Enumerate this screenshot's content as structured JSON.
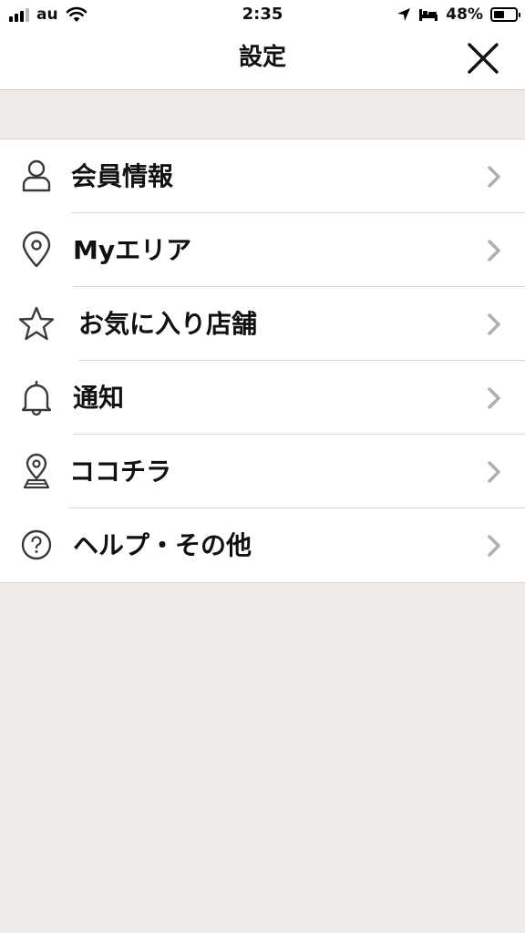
{
  "status_bar": {
    "carrier": "au",
    "time": "2:35",
    "battery_percent": "48%",
    "battery_level": 0.48,
    "icons": [
      "cellular-signal-icon",
      "wifi-icon",
      "location-arrow-icon",
      "sleep-bed-icon",
      "battery-icon"
    ]
  },
  "header": {
    "title": "設定",
    "close_icon": "close-icon"
  },
  "menu": {
    "items": [
      {
        "label": "会員情報",
        "icon": "person-icon"
      },
      {
        "label": "Myエリア",
        "icon": "map-pin-icon"
      },
      {
        "label": "お気に入り店舗",
        "icon": "star-icon"
      },
      {
        "label": "通知",
        "icon": "bell-icon"
      },
      {
        "label": "ココチラ",
        "icon": "location-map-icon"
      },
      {
        "label": "ヘルプ・その他",
        "icon": "help-circle-icon"
      }
    ],
    "chevron_icon": "chevron-right-icon"
  },
  "colors": {
    "background": "#efebe8",
    "surface": "#ffffff",
    "text": "#111111",
    "chevron": "#b0b0b0",
    "divider": "#d9d6d3"
  }
}
